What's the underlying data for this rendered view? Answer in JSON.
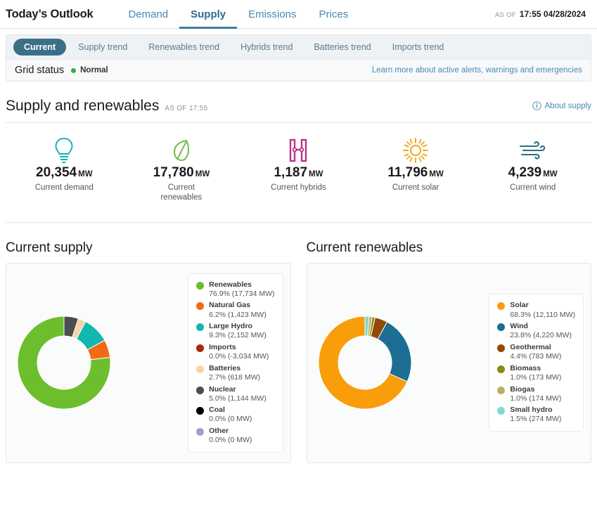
{
  "header": {
    "brand": "Today’s Outlook",
    "tabs": [
      {
        "label": "Demand",
        "active": false
      },
      {
        "label": "Supply",
        "active": true
      },
      {
        "label": "Emissions",
        "active": false
      },
      {
        "label": "Prices",
        "active": false
      }
    ],
    "asof_label": "AS OF",
    "asof_value": "17:55 04/28/2024"
  },
  "subnav": {
    "items": [
      {
        "label": "Current",
        "active": true
      },
      {
        "label": "Supply trend",
        "active": false
      },
      {
        "label": "Renewables trend",
        "active": false
      },
      {
        "label": "Hybrids trend",
        "active": false
      },
      {
        "label": "Batteries trend",
        "active": false
      },
      {
        "label": "Imports trend",
        "active": false
      }
    ]
  },
  "grid_status": {
    "title": "Grid status",
    "state": "Normal",
    "state_color": "#35b135",
    "link": "Learn more about active alerts, warnings and emergencies"
  },
  "section": {
    "title": "Supply and renewables",
    "asof": "AS OF 17:55",
    "about": "About supply",
    "about_icon": "info-icon"
  },
  "kpis": [
    {
      "icon": "lightbulb-icon",
      "color": "#14b3bd",
      "value": "20,354",
      "unit": "MW",
      "label": "Current demand",
      "wrap": false
    },
    {
      "icon": "leaf-icon",
      "color": "#6fbe44",
      "value": "17,780",
      "unit": "MW",
      "label": "Current renewables",
      "wrap": true
    },
    {
      "icon": "hybrid-icon",
      "color": "#b8338c",
      "value": "1,187",
      "unit": "MW",
      "label": "Current hybrids",
      "wrap": false
    },
    {
      "icon": "sun-icon",
      "color": "#f0a818",
      "value": "11,796",
      "unit": "MW",
      "label": "Current solar",
      "wrap": false
    },
    {
      "icon": "wind-icon",
      "color": "#2d6b86",
      "value": "4,239",
      "unit": "MW",
      "label": "Current wind",
      "wrap": false
    }
  ],
  "charts": [
    {
      "title": "Current supply",
      "chart_data": {
        "type": "pie",
        "title": "Current supply",
        "unit": "MW",
        "legend_position": "right",
        "categories": [
          "Renewables",
          "Natural Gas",
          "Large Hydro",
          "Imports",
          "Batteries",
          "Nuclear",
          "Coal",
          "Other"
        ],
        "values": [
          17734,
          1423,
          2152,
          -3034,
          618,
          1144,
          0,
          0
        ],
        "percents": [
          76.9,
          6.2,
          9.3,
          0.0,
          2.7,
          5.0,
          0.0,
          0.0
        ],
        "colors": [
          "#6cbe2c",
          "#f26a16",
          "#10b8b0",
          "#ac2808",
          "#f9d3a3",
          "#4d4d4d",
          "#000000",
          "#a79ec4"
        ],
        "labels": [
          "76.9% (17,734 MW)",
          "6.2% (1,423 MW)",
          "9.3% (2,152 MW)",
          "0.0% (-3,034 MW)",
          "2.7% (618 MW)",
          "5.0% (1,144 MW)",
          "0.0% (0 MW)",
          "0.0% (0 MW)"
        ]
      }
    },
    {
      "title": "Current renewables",
      "chart_data": {
        "type": "pie",
        "title": "Current renewables",
        "unit": "MW",
        "legend_position": "right",
        "categories": [
          "Solar",
          "Wind",
          "Geothermal",
          "Biomass",
          "Biogas",
          "Small hydro"
        ],
        "values": [
          12110,
          4220,
          783,
          173,
          174,
          274
        ],
        "percents": [
          68.3,
          23.8,
          4.4,
          1.0,
          1.0,
          1.5
        ],
        "colors": [
          "#f99d0a",
          "#1c6e94",
          "#934808",
          "#8a8a14",
          "#bab060",
          "#7fd8d6"
        ],
        "labels": [
          "68.3% (12,110 MW)",
          "23.8% (4,220 MW)",
          "4.4% (783 MW)",
          "1.0% (173 MW)",
          "1.0% (174 MW)",
          "1.5% (274 MW)"
        ]
      }
    }
  ]
}
